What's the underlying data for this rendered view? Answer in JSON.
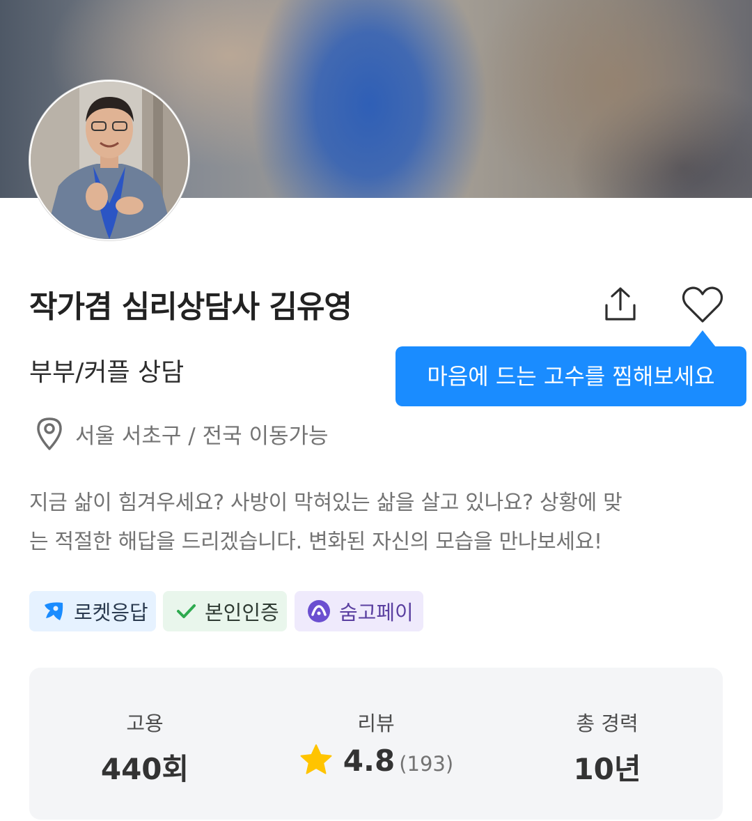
{
  "profile": {
    "name": "작가겸 심리상담사 김유영",
    "category": "부부/커플 상담",
    "location": "서울 서초구 / 전국 이동가능",
    "description_line1": "지금 삶이 힘겨우세요? 사방이 막혀있는 삶을 살고 있나요? 상황에 맞",
    "description_line2": "는 적절한 해답을 드리겠습니다. 변화된 자신의 모습을 만나보세요!"
  },
  "actions": {
    "share_icon": "share-icon",
    "favorite_icon": "heart-icon",
    "tooltip": "마음에 드는 고수를 찜해보세요"
  },
  "badges": [
    {
      "label": "로켓응답",
      "icon": "rocket-icon",
      "color": "#1a8cff"
    },
    {
      "label": "본인인증",
      "icon": "check-icon",
      "color": "#2eaa4f"
    },
    {
      "label": "숨고페이",
      "icon": "soomgo-pay-icon",
      "color": "#6b4fd0"
    }
  ],
  "stats": {
    "hires_label": "고용",
    "hires_value": "440회",
    "reviews_label": "리뷰",
    "reviews_score": "4.8",
    "reviews_count": "(193)",
    "career_label": "총 경력",
    "career_value": "10년"
  },
  "colors": {
    "accent": "#1a8cff",
    "star": "#ffc400"
  }
}
